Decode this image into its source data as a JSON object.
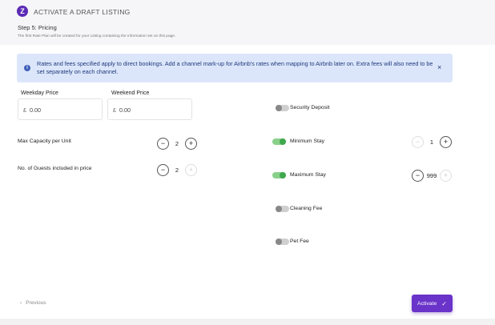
{
  "header": {
    "logo_glyph": "Z",
    "title": "ACTIVATE A DRAFT LISTING",
    "step": "Step 5:  Pricing",
    "note": "The first Rate Plan will be created for your Listing containing the information set on this page."
  },
  "banner": {
    "icon": "i",
    "text": "Rates and fees specified apply to direct bookings. Add a channel mark-up for Airbnb's rates when mapping to Airbnb later on. Extra fees will also need to be set separately on each channel.",
    "close": "×"
  },
  "prices": {
    "weekday_label": "Weekday Price",
    "weekday_currency": "£",
    "weekday_value": "0.00",
    "weekend_label": "Weekend Price",
    "weekend_currency": "£",
    "weekend_value": "0.00"
  },
  "capacity": {
    "label": "Max Capacity per Unit",
    "value": "2",
    "minus": "−",
    "plus": "+"
  },
  "guests": {
    "label": "No. of Guests included in price",
    "value": "2",
    "minus": "−",
    "plus": "+"
  },
  "settings": {
    "security_deposit": {
      "label": "Security Deposit",
      "enabled": false
    },
    "minimum_stay": {
      "label": "Minimum Stay",
      "enabled": true,
      "value": "1",
      "minus": "−",
      "plus": "+"
    },
    "maximum_stay": {
      "label": "Maximum Stay",
      "enabled": true,
      "value": "999",
      "minus": "−",
      "plus": "+"
    },
    "cleaning_fee": {
      "label": "Cleaning Fee",
      "enabled": false
    },
    "pet_fee": {
      "label": "Pet Fee",
      "enabled": false
    }
  },
  "footer": {
    "previous_chevron": "‹",
    "previous_label": "Previous",
    "activate_label": "Activate",
    "activate_check": "✓"
  },
  "colors": {
    "accent": "#6a33c9",
    "banner_bg": "#dce6fb",
    "toggle_on": "#3fa84e"
  }
}
